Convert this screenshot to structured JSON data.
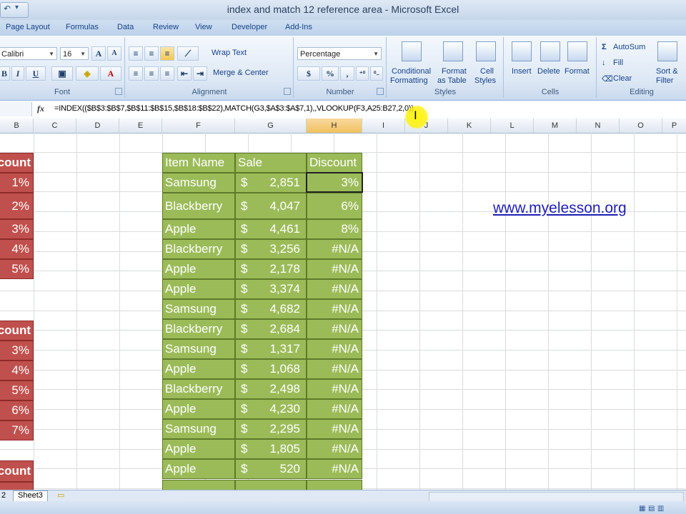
{
  "window": {
    "title": "index and match 12 reference area - Microsoft Excel"
  },
  "tabs": [
    "Page Layout",
    "Formulas",
    "Data",
    "Review",
    "View",
    "Developer",
    "Add-Ins"
  ],
  "ribbon": {
    "font": {
      "name": "Calibri",
      "size": "16",
      "group_label": "Font",
      "bold": "B",
      "italic": "I",
      "underline": "U",
      "grow": "A",
      "shrink": "A"
    },
    "alignment": {
      "wrap_text": "Wrap Text",
      "merge_center": "Merge & Center",
      "group_label": "Alignment"
    },
    "number": {
      "format": "Percentage",
      "currency": "$",
      "percent": "%",
      "comma": ",",
      "group_label": "Number"
    },
    "styles": {
      "conditional_1": "Conditional",
      "conditional_2": "Formatting",
      "format_table_1": "Format",
      "format_table_2": "as Table",
      "cell_styles_1": "Cell",
      "cell_styles_2": "Styles",
      "group_label": "Styles"
    },
    "cells": {
      "insert": "Insert",
      "delete": "Delete",
      "format": "Format",
      "group_label": "Cells"
    },
    "editing": {
      "autosum": "AutoSum",
      "fill": "Fill",
      "clear": "Clear",
      "sort_1": "Sort &",
      "sort_2": "Filter",
      "group_label": "Editing"
    }
  },
  "formula_bar": {
    "fx": "fx",
    "formula": "=INDEX(($B$3:$B$7,$B$11:$B$15,$B$18:$B$22),MATCH(G3,$A$3:$A$7,1),,VLOOKUP(F3,A25:B27,2,0))"
  },
  "columns": [
    "B",
    "C",
    "D",
    "E",
    "F",
    "G",
    "H",
    "I",
    "J",
    "K",
    "L",
    "M",
    "N",
    "O",
    "P"
  ],
  "left_table_1": {
    "header": "count",
    "values": [
      "1%",
      "2%",
      "3%",
      "4%",
      "5%"
    ]
  },
  "left_table_2": {
    "header": "count",
    "values": [
      "3%",
      "4%",
      "5%",
      "6%",
      "7%"
    ]
  },
  "left_table_3": {
    "header": "count"
  },
  "main_table": {
    "headers": [
      "Item Name",
      "Sale",
      "Discount"
    ],
    "rows": [
      {
        "name": "Samsung",
        "cur": "$",
        "sale": "2,851",
        "discount": "3%"
      },
      {
        "name": "Blackberry",
        "cur": "$",
        "sale": "4,047",
        "discount": "6%"
      },
      {
        "name": "Apple",
        "cur": "$",
        "sale": "4,461",
        "discount": "8%"
      },
      {
        "name": "Blackberry",
        "cur": "$",
        "sale": "3,256",
        "discount": "#N/A"
      },
      {
        "name": "Apple",
        "cur": "$",
        "sale": "2,178",
        "discount": "#N/A"
      },
      {
        "name": "Apple",
        "cur": "$",
        "sale": "3,374",
        "discount": "#N/A"
      },
      {
        "name": "Samsung",
        "cur": "$",
        "sale": "4,682",
        "discount": "#N/A"
      },
      {
        "name": "Blackberry",
        "cur": "$",
        "sale": "2,684",
        "discount": "#N/A"
      },
      {
        "name": "Samsung",
        "cur": "$",
        "sale": "1,317",
        "discount": "#N/A"
      },
      {
        "name": "Apple",
        "cur": "$",
        "sale": "1,068",
        "discount": "#N/A"
      },
      {
        "name": "Blackberry",
        "cur": "$",
        "sale": "2,498",
        "discount": "#N/A"
      },
      {
        "name": "Apple",
        "cur": "$",
        "sale": "4,230",
        "discount": "#N/A"
      },
      {
        "name": "Samsung",
        "cur": "$",
        "sale": "2,295",
        "discount": "#N/A"
      },
      {
        "name": "Apple",
        "cur": "$",
        "sale": "1,805",
        "discount": "#N/A"
      },
      {
        "name": "Apple",
        "cur": "$",
        "sale": "520",
        "discount": "#N/A"
      }
    ]
  },
  "website": "www.myelesson.org",
  "sheets": [
    "2",
    "Sheet3"
  ]
}
